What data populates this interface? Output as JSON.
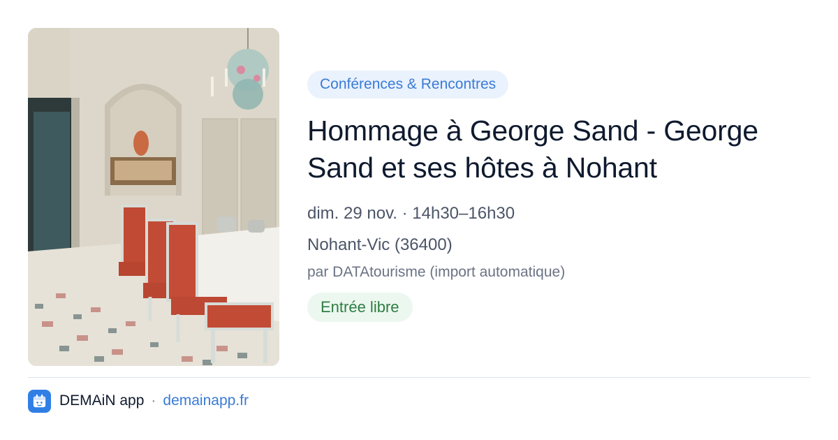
{
  "event": {
    "category": "Conférences & Rencontres",
    "title": "Hommage à George Sand - George Sand et ses hôtes à Nohant",
    "date": "dim. 29 nov. · 14h30–16h30",
    "location": "Nohant-Vic (36400)",
    "source": "par DATAtourisme (import automatique)",
    "price": "Entrée libre"
  },
  "footer": {
    "app_name": "DEMAiN app",
    "separator": "·",
    "url": "demainapp.fr"
  },
  "colors": {
    "category_chip_bg": "#eaf2fd",
    "category_chip_text": "#3a7bd5",
    "price_chip_bg": "#ecf8ef",
    "price_chip_text": "#2e7d43",
    "link": "#3a7bd5",
    "app_icon": "#2f7fe6"
  },
  "icons": {
    "app": "calendar-icon"
  }
}
